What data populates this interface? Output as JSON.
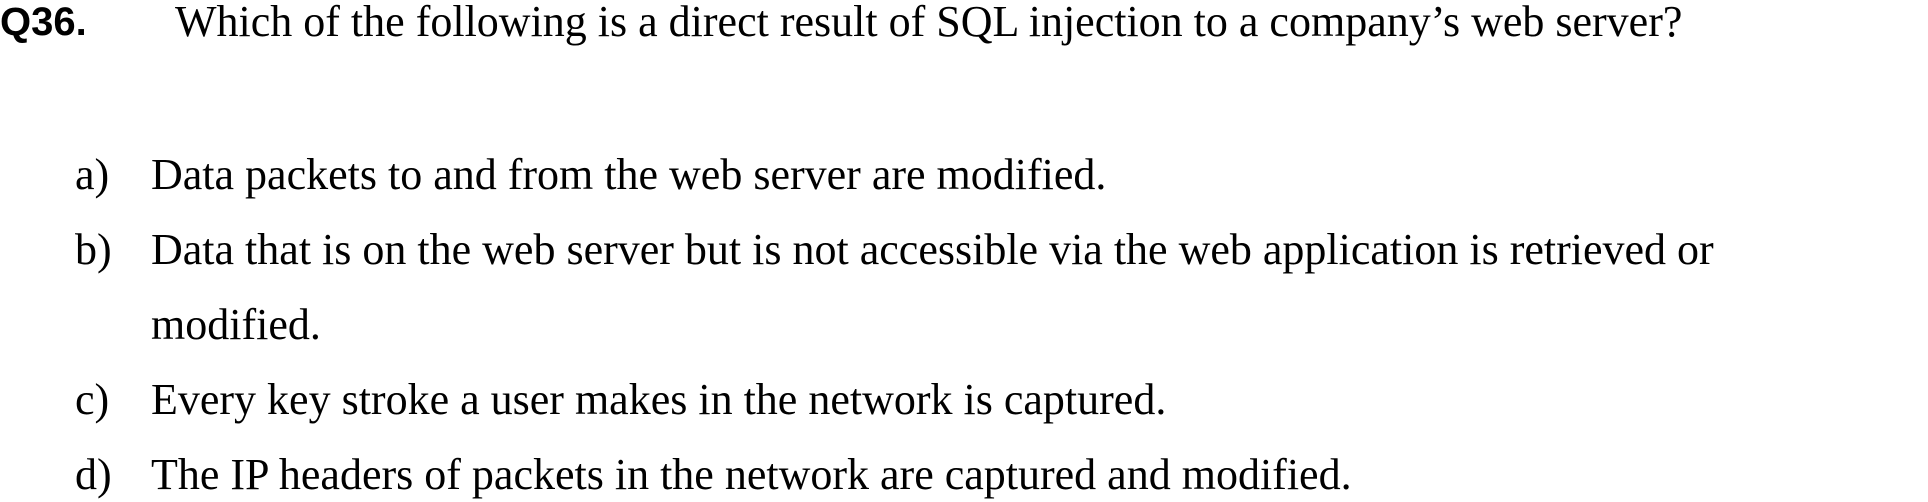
{
  "question": {
    "number": "Q36.",
    "text": "Which of the following is a direct result of SQL injection to a company’s web server?"
  },
  "options": [
    {
      "letter": "a)",
      "lines": [
        "Data packets to and from the web server are modified."
      ]
    },
    {
      "letter": "b)",
      "lines": [
        "Data that is on the web server but is not accessible via the web application is retrieved or",
        "modified."
      ]
    },
    {
      "letter": "c)",
      "lines": [
        "Every key stroke a user makes in the network is captured."
      ]
    },
    {
      "letter": "d)",
      "lines": [
        "The IP headers of packets in the network are captured and modified."
      ]
    }
  ]
}
